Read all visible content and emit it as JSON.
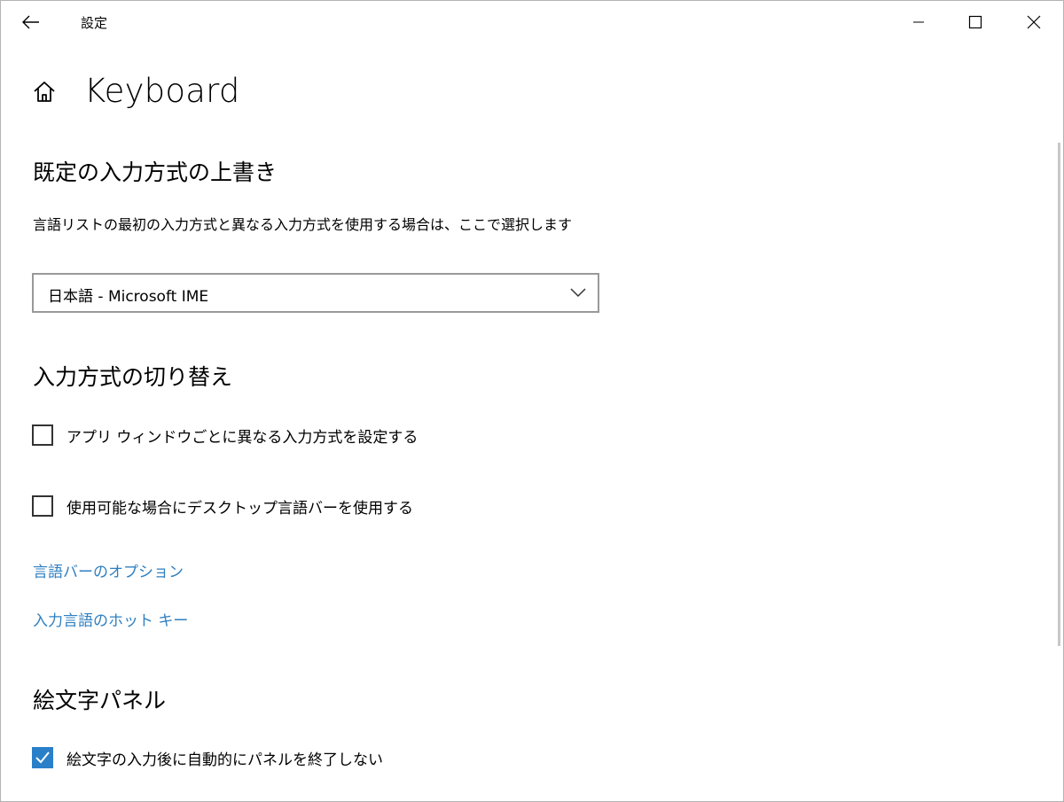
{
  "window": {
    "title": "設定"
  },
  "page": {
    "title": "Keyboard"
  },
  "section_override": {
    "heading": "既定の入力方式の上書き",
    "description": "言語リストの最初の入力方式と異なる入力方式を使用する場合は、ここで選択します",
    "dropdown_value": "日本語 - Microsoft IME"
  },
  "section_switch": {
    "heading": "入力方式の切り替え",
    "checkbox_per_app": {
      "label": "アプリ ウィンドウごとに異なる入力方式を設定する",
      "checked": false
    },
    "checkbox_desktop_bar": {
      "label": "使用可能な場合にデスクトップ言語バーを使用する",
      "checked": false
    },
    "link_language_bar_options": "言語バーのオプション",
    "link_hotkeys": "入力言語のホット キー"
  },
  "section_emoji": {
    "heading": "絵文字パネル",
    "checkbox_keep_open": {
      "label": "絵文字の入力後に自動的にパネルを終了しない",
      "checked": true
    }
  },
  "colors": {
    "accent": "#2a7fc9",
    "link": "#2f7fc1"
  }
}
